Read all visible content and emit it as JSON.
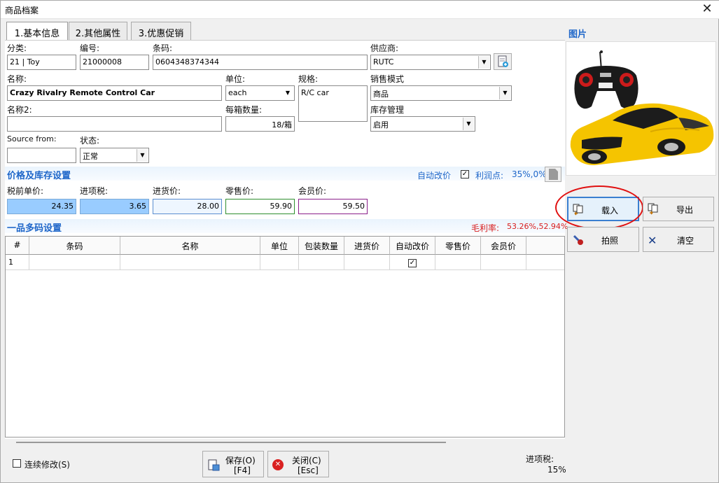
{
  "window": {
    "title": "商品档案",
    "close": "✕"
  },
  "tabs": [
    {
      "label": "1.基本信息"
    },
    {
      "label": "2.其他属性"
    },
    {
      "label": "3.优惠促销"
    }
  ],
  "basic": {
    "category_label": "分类:",
    "category_value": "21 | Toy",
    "code_label": "编号:",
    "code_value": "21000008",
    "barcode_label": "条码:",
    "barcode_value": "0604348374344",
    "supplier_label": "供应商:",
    "supplier_value": "RUTC",
    "name_label": "名称:",
    "name_value": "Crazy Rivalry Remote Control Car",
    "unit_label": "单位:",
    "unit_value": "each",
    "spec_label": "规格:",
    "spec_value": "R/C car",
    "sales_mode_label": "销售模式",
    "sales_mode_value": "商品",
    "name2_label": "名称2:",
    "name2_value": "",
    "qty_per_box_label": "每箱数量:",
    "qty_per_box_value": "18/箱",
    "stock_mgmt_label": "库存管理",
    "stock_mgmt_value": "启用",
    "source_label": "Source from:",
    "source_value": "",
    "status_label": "状态:",
    "status_value": "正常"
  },
  "price_section": {
    "title": "价格及库存设置",
    "auto_price_label": "自动改价",
    "auto_price_checked": "✓",
    "profit_label": "利润点:",
    "profit_value": "35%,0%",
    "pretax_label": "税前单价:",
    "pretax_value": "24.35",
    "input_tax_label": "进项税:",
    "input_tax_value": "3.65",
    "purchase_label": "进货价:",
    "purchase_value": "28.00",
    "retail_label": "零售价:",
    "retail_value": "59.90",
    "member_label": "会员价:",
    "member_value": "59.50"
  },
  "multicode_section": {
    "title": "一品多码设置",
    "margin_label": "毛利率:",
    "margin_value": "53.26%,52.94%",
    "columns": [
      "#",
      "条码",
      "名称",
      "单位",
      "包装数量",
      "进货价",
      "自动改价",
      "零售价",
      "会员价"
    ],
    "rows": [
      {
        "index": "1",
        "auto": "✓"
      }
    ]
  },
  "image_panel": {
    "title": "图片",
    "load_button": "载入",
    "export_button": "导出",
    "photo_button": "拍照",
    "clear_button": "清空"
  },
  "footer": {
    "continuous_label": "连续修改(S)",
    "save_button_line1": "保存(O)",
    "save_button_line2": "[F4]",
    "close_button_line1": "关闭(C)",
    "close_button_line2": "[Esc]",
    "input_tax_label": "进项税:",
    "input_tax_value": "15%"
  },
  "colors": {
    "accent": "#1e66c9",
    "highlight_blue": "#99ccff",
    "retail_border": "#2f8f2f",
    "member_border": "#8a1f8a",
    "annotation_red": "#e01010",
    "car_yellow": "#f5c400"
  }
}
